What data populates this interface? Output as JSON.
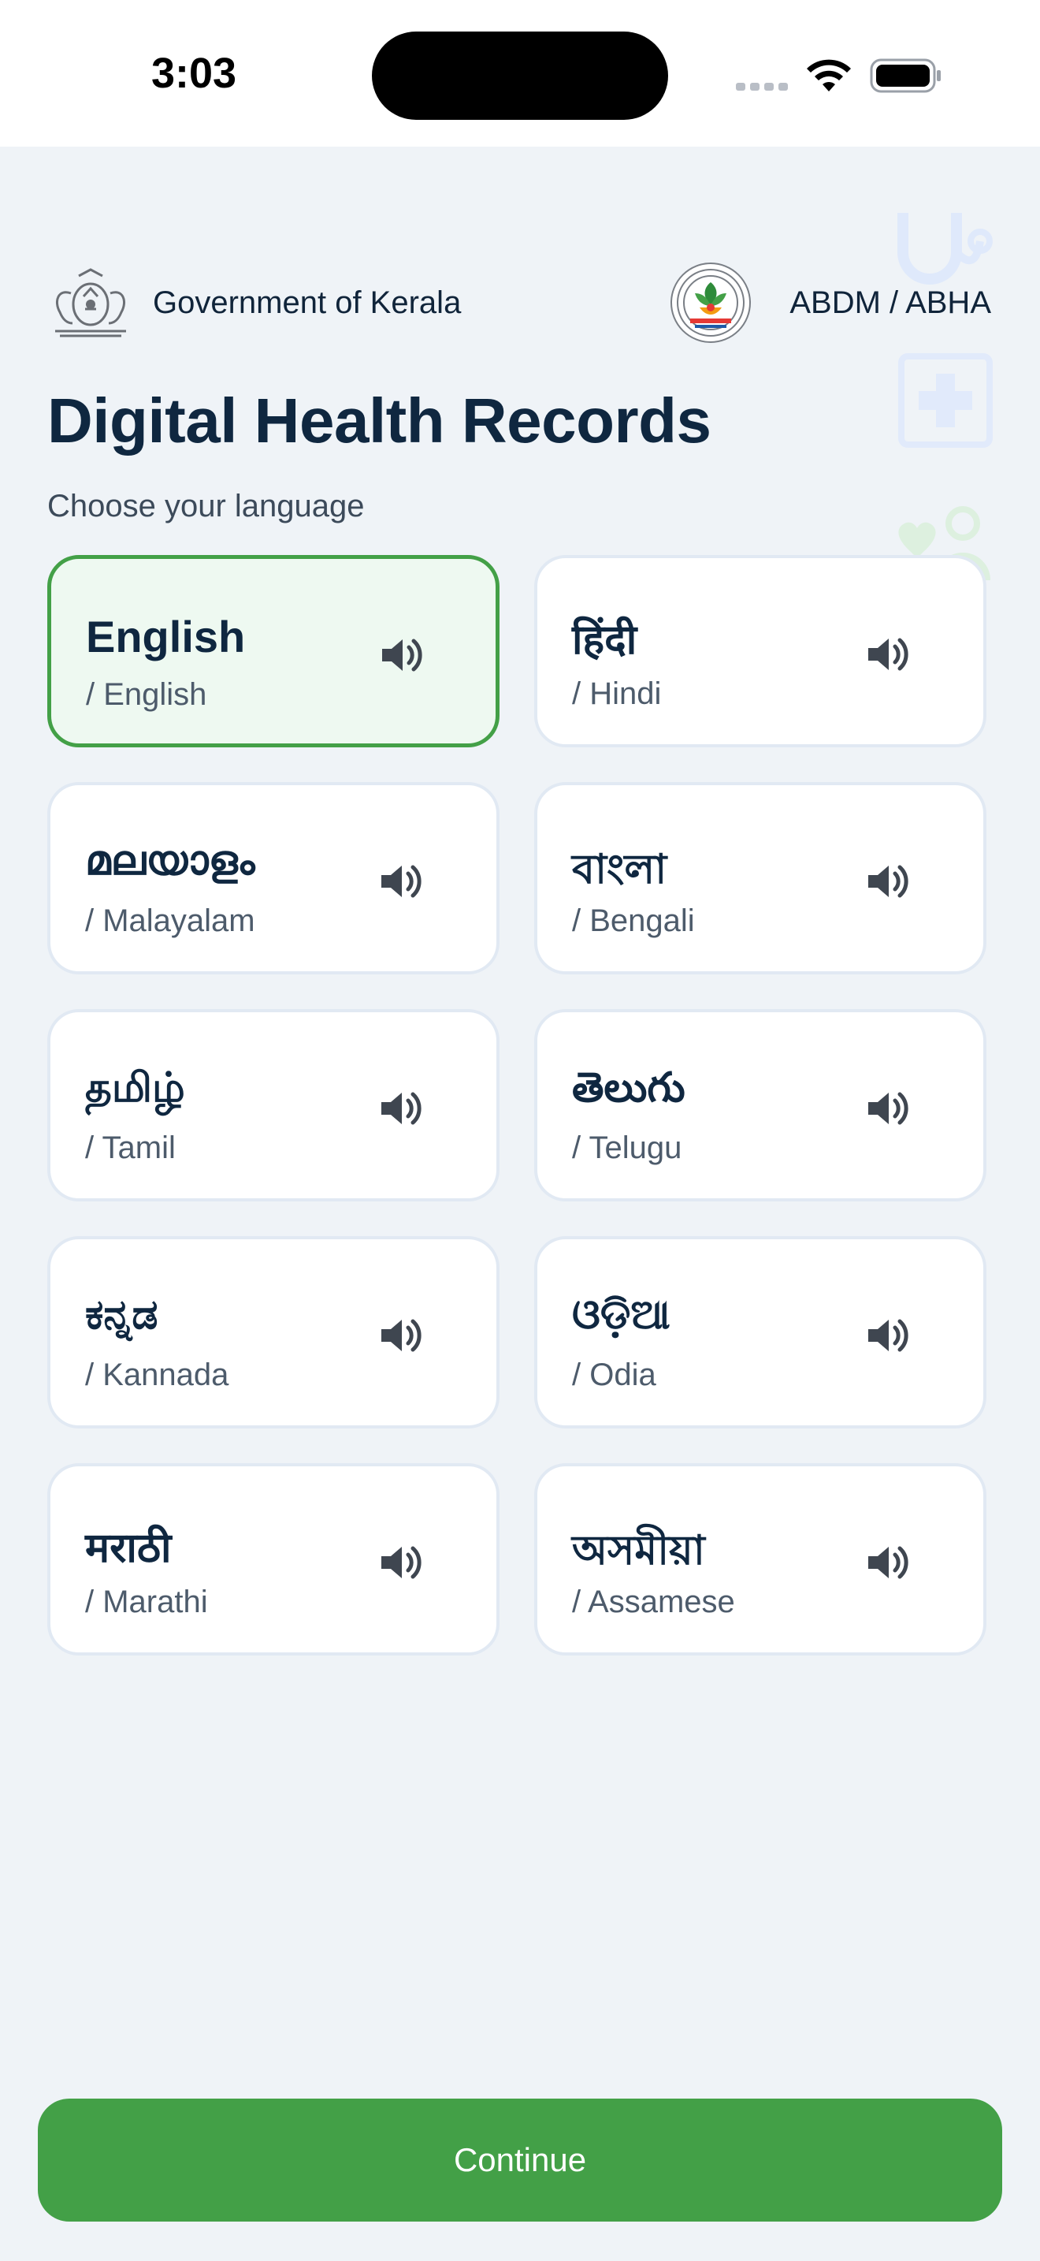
{
  "status_bar": {
    "time": "3:03"
  },
  "header": {
    "gov_label": "Government of Kerala",
    "partner_label": "ABDM / ABHA"
  },
  "page": {
    "title": "Digital Health Records",
    "subtitle": "Choose your language"
  },
  "languages": [
    {
      "native": "English",
      "english": "/ English",
      "selected": true
    },
    {
      "native": "हिंदी",
      "english": "/ Hindi",
      "selected": false
    },
    {
      "native": "മലയാളം",
      "english": "/ Malayalam",
      "selected": false
    },
    {
      "native": "বাংলা",
      "english": "/ Bengali",
      "selected": false
    },
    {
      "native": "தமிழ்",
      "english": "/ Tamil",
      "selected": false
    },
    {
      "native": "తెలుగు",
      "english": "/ Telugu",
      "selected": false
    },
    {
      "native": "ಕನ್ನಡ",
      "english": "/ Kannada",
      "selected": false
    },
    {
      "native": "ଓଡ଼ିଆ",
      "english": "/ Odia",
      "selected": false
    },
    {
      "native": "मराठी",
      "english": "/ Marathi",
      "selected": false
    },
    {
      "native": "অসমীয়া",
      "english": "/ Assamese",
      "selected": false
    }
  ],
  "footer": {
    "continue_label": "Continue"
  },
  "colors": {
    "accent": "#43a047",
    "selected_bg": "#eef9f1",
    "card_border": "#e1e9f3",
    "background": "#eff3f7",
    "title": "#0f2740"
  },
  "icons": {
    "speaker": "speaker-icon",
    "gov_emblem": "kerala-emblem-icon",
    "partner_logo": "abdm-logo-icon"
  }
}
